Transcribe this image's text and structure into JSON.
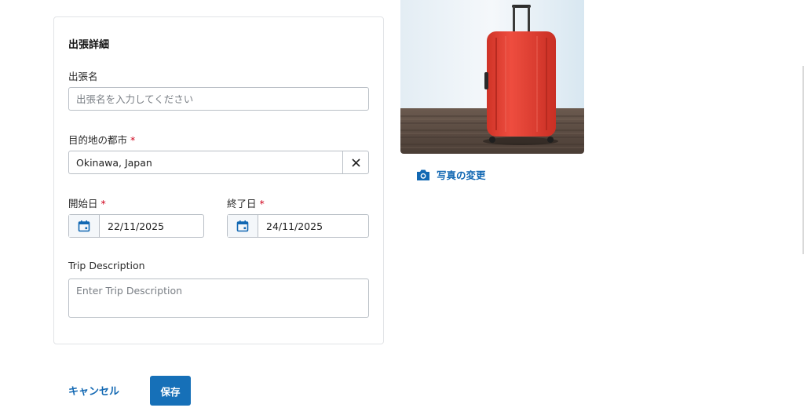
{
  "form": {
    "section_title": "出張詳細",
    "trip_name": {
      "label": "出張名",
      "placeholder": "出張名を入力してください",
      "value": ""
    },
    "destination_city": {
      "label": "目的地の都市",
      "required_mark": "*",
      "value": "Okinawa, Japan",
      "clear_icon": "close-icon"
    },
    "start_date": {
      "label": "開始日",
      "required_mark": "*",
      "value": "22/11/2025",
      "icon": "calendar-icon"
    },
    "end_date": {
      "label": "終了日",
      "required_mark": "*",
      "value": "24/11/2025",
      "icon": "calendar-icon"
    },
    "trip_description": {
      "label": "Trip Description",
      "placeholder": "Enter Trip Description",
      "value": ""
    }
  },
  "photo": {
    "change_label": "写真の変更",
    "change_icon": "camera-icon"
  },
  "actions": {
    "cancel_label": "キャンセル",
    "save_label": "保存"
  },
  "colors": {
    "accent": "#1670b8",
    "link": "#1268b3",
    "required": "#d0021b",
    "border": "#b9bfc6",
    "suitcase": "#e8453a"
  }
}
